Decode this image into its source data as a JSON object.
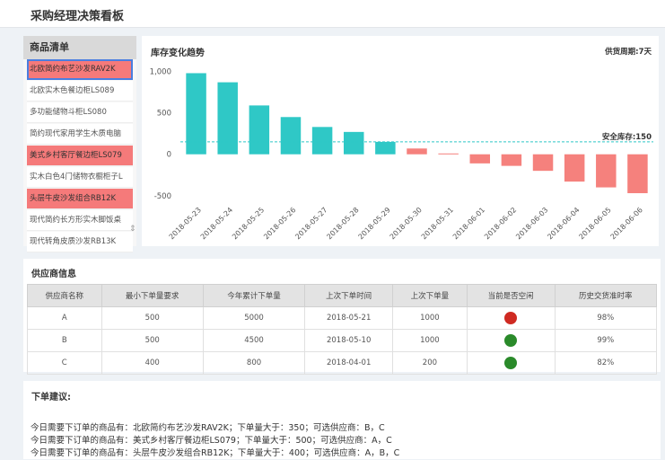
{
  "app": {
    "title": "采购经理决策看板"
  },
  "products": {
    "header": "商品清单",
    "items": [
      {
        "label": "北欧简约布艺沙发RAV2K",
        "need": true,
        "selected": true
      },
      {
        "label": "北欧实木色餐边柜LS089",
        "need": false,
        "selected": false
      },
      {
        "label": "多功能储物斗柜LS080",
        "need": false,
        "selected": false
      },
      {
        "label": "简约现代家用学生木质电脑",
        "need": false,
        "selected": false
      },
      {
        "label": "美式乡村客厅餐边柜LS079",
        "need": true,
        "selected": false
      },
      {
        "label": "实木白色4门储物衣橱柜子L",
        "need": false,
        "selected": false
      },
      {
        "label": "头层牛皮沙发组合RB12K",
        "need": true,
        "selected": false
      },
      {
        "label": "现代简约长方形实木脚饭桌",
        "need": false,
        "selected": false
      },
      {
        "label": "现代转角皮质沙发RB13K",
        "need": false,
        "selected": false
      }
    ]
  },
  "chart": {
    "title": "库存变化趋势",
    "cycle_label": "供货周期:7天",
    "safety_label": "安全库存:150"
  },
  "chart_data": {
    "type": "bar",
    "title": "库存变化趋势",
    "categories": [
      "2018-05-23",
      "2018-05-24",
      "2018-05-25",
      "2018-05-26",
      "2018-05-27",
      "2018-05-28",
      "2018-05-29",
      "2018-05-30",
      "2018-05-31",
      "2018-06-01",
      "2018-06-02",
      "2018-06-03",
      "2018-06-04",
      "2018-06-05",
      "2018-06-06"
    ],
    "values": [
      980,
      870,
      590,
      450,
      330,
      270,
      150,
      70,
      10,
      -110,
      -140,
      -200,
      -330,
      -400,
      -470
    ],
    "ylim": [
      -600,
      1050
    ],
    "yticks": [
      1000,
      500,
      0,
      -500
    ],
    "ytick_labels": [
      "1,000",
      "500",
      "0",
      "-500"
    ],
    "safety_stock": 150,
    "colors": {
      "above": "#2fc8c6",
      "below": "#f5817d",
      "safety_line": "#2fc8c6"
    },
    "grid": false,
    "legend": "none"
  },
  "supplier": {
    "title": "供应商信息",
    "columns": [
      "供应商名称",
      "最小下单量要求",
      "今年累计下单量",
      "上次下单时间",
      "上次下单量",
      "当前是否空闲",
      "历史交货准时率"
    ],
    "rows": [
      {
        "name": "A",
        "min": "500",
        "total": "5000",
        "last_time": "2018-05-21",
        "last_qty": "1000",
        "status_color": "#cf2a22",
        "rate": "98%"
      },
      {
        "name": "B",
        "min": "500",
        "total": "4500",
        "last_time": "2018-05-10",
        "last_qty": "1000",
        "status_color": "#2a8a2a",
        "rate": "99%"
      },
      {
        "name": "C",
        "min": "400",
        "total": "800",
        "last_time": "2018-04-01",
        "last_qty": "200",
        "status_color": "#2a8a2a",
        "rate": "82%"
      }
    ]
  },
  "advice": {
    "title": "下单建议:",
    "lines": [
      "今日需要下订单的商品有：北欧简约布艺沙发RAV2K；下单量大于：350；可选供应商：B，C",
      "今日需要下订单的商品有：美式乡村客厅餐边柜LS079；下单量大于：500；可选供应商：A，C",
      "今日需要下订单的商品有：头层牛皮沙发组合RB12K；下单量大于：400；可选供应商：A，B，C"
    ]
  }
}
